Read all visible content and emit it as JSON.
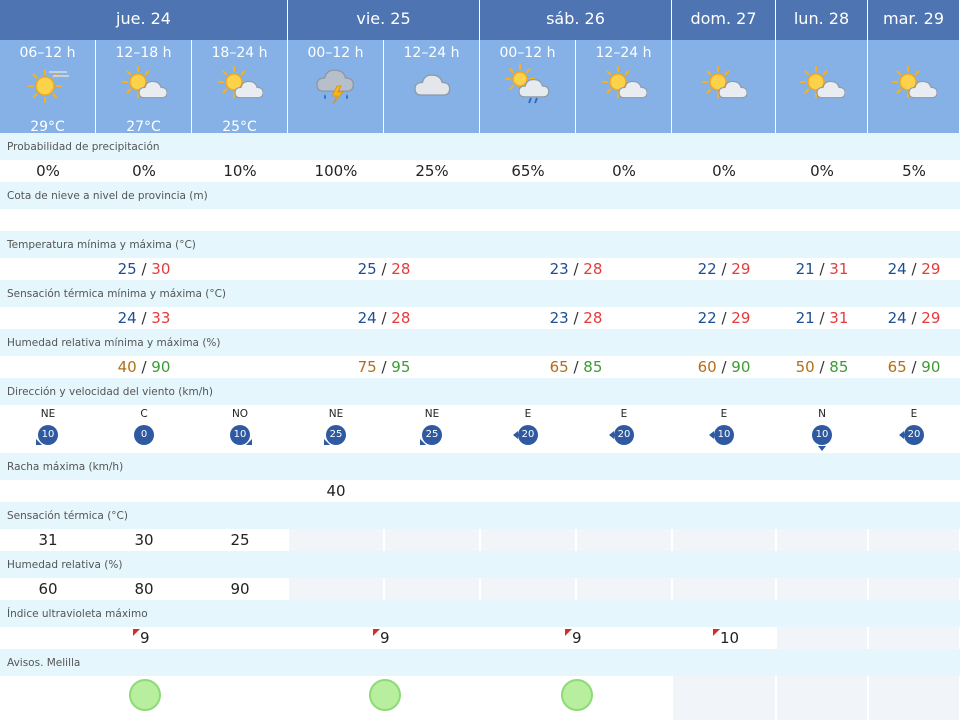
{
  "days": [
    {
      "label": "jue. 24"
    },
    {
      "label": "vie. 25"
    },
    {
      "label": "sáb. 26"
    },
    {
      "label": "dom. 27"
    },
    {
      "label": "lun. 28"
    },
    {
      "label": "mar. 29"
    }
  ],
  "periods": [
    {
      "label": "06–12 h",
      "icon": "sun-haze-icon",
      "temp": "29°C"
    },
    {
      "label": "12–18 h",
      "icon": "sun-cloud-icon",
      "temp": "27°C"
    },
    {
      "label": "18–24 h",
      "icon": "sun-cloud-icon",
      "temp": "25°C"
    },
    {
      "label": "00–12 h",
      "icon": "storm-rain-icon",
      "temp": ""
    },
    {
      "label": "12–24 h",
      "icon": "cloud-icon",
      "temp": ""
    },
    {
      "label": "00–12 h",
      "icon": "sun-cloud-rain-icon",
      "temp": ""
    },
    {
      "label": "12–24 h",
      "icon": "sun-cloud-icon",
      "temp": ""
    },
    {
      "label": "",
      "icon": "sun-cloud-icon",
      "temp": ""
    },
    {
      "label": "",
      "icon": "sun-cloud-icon",
      "temp": ""
    },
    {
      "label": "",
      "icon": "sun-cloud-icon",
      "temp": ""
    }
  ],
  "labels": {
    "precip": "Probabilidad de precipitación",
    "snow": "Cota de nieve a nivel de provincia (m)",
    "temp": "Temperatura mínima y máxima (°C)",
    "feels": "Sensación térmica mínima y máxima (°C)",
    "hum": "Humedad relativa mínima y máxima (%)",
    "wind": "Dirección y velocidad del viento (km/h)",
    "gust": "Racha máxima (km/h)",
    "feelsp": "Sensación térmica (°C)",
    "hump": "Humedad relativa (%)",
    "uv": "Índice ultravioleta máximo",
    "warn": "Avisos. Melilla"
  },
  "precip": [
    "0%",
    "0%",
    "10%",
    "100%",
    "25%",
    "65%",
    "0%",
    "0%",
    "0%",
    "5%"
  ],
  "temp": [
    {
      "min": "25",
      "max": "30"
    },
    {
      "min": "25",
      "max": "28"
    },
    {
      "min": "23",
      "max": "28"
    },
    {
      "min": "22",
      "max": "29"
    },
    {
      "min": "21",
      "max": "31"
    },
    {
      "min": "24",
      "max": "29"
    }
  ],
  "feels": [
    {
      "min": "24",
      "max": "33"
    },
    {
      "min": "24",
      "max": "28"
    },
    {
      "min": "23",
      "max": "28"
    },
    {
      "min": "22",
      "max": "29"
    },
    {
      "min": "21",
      "max": "31"
    },
    {
      "min": "24",
      "max": "29"
    }
  ],
  "hum": [
    {
      "min": "40",
      "max": "90"
    },
    {
      "min": "75",
      "max": "95"
    },
    {
      "min": "65",
      "max": "85"
    },
    {
      "min": "60",
      "max": "90"
    },
    {
      "min": "50",
      "max": "85"
    },
    {
      "min": "65",
      "max": "90"
    }
  ],
  "wind": [
    {
      "dir": "NE",
      "speed": "10"
    },
    {
      "dir": "C",
      "speed": "0"
    },
    {
      "dir": "NO",
      "speed": "10"
    },
    {
      "dir": "NE",
      "speed": "25"
    },
    {
      "dir": "NE",
      "speed": "25"
    },
    {
      "dir": "E",
      "speed": "20"
    },
    {
      "dir": "E",
      "speed": "20"
    },
    {
      "dir": "E",
      "speed": "10"
    },
    {
      "dir": "N",
      "speed": "10"
    },
    {
      "dir": "E",
      "speed": "20"
    }
  ],
  "gust": [
    "",
    "",
    "",
    "40",
    "",
    "",
    "",
    "",
    "",
    ""
  ],
  "feelsp": [
    "31",
    "30",
    "25"
  ],
  "hump": [
    "60",
    "80",
    "90"
  ],
  "uv": [
    "9",
    "9",
    "9",
    "10",
    "",
    ""
  ],
  "warn": [
    "green",
    "green",
    "green",
    "",
    "",
    ""
  ],
  "colors": {
    "header_dark": "#4e74b2",
    "header_light": "#86b1e6",
    "label_bg": "#e5f6fd",
    "temp_min": "#1d4f91",
    "temp_max": "#e43b3b",
    "hum_min": "#b56e18",
    "hum_max": "#3d9b35",
    "wind_badge": "#2f5aa2",
    "uv_flag": "#d72c2c",
    "warning_green": "#b8ef9f"
  }
}
